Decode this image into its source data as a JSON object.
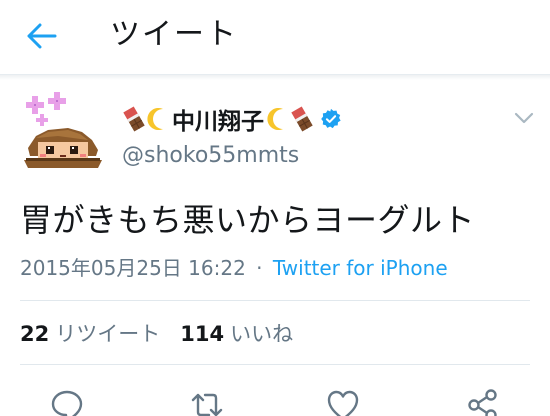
{
  "header": {
    "title": "ツイート"
  },
  "author": {
    "display_name": "中川翔子",
    "username": "@shoko55mmts",
    "verified": true
  },
  "tweet": {
    "text": "胃がきもち悪いからヨーグルト",
    "timestamp": "2015年05月25日 16:22",
    "separator": "·",
    "source": "Twitter for iPhone"
  },
  "stats": {
    "retweets_count": "22",
    "retweets_label": "リツイート",
    "likes_count": "114",
    "likes_label": "いいね"
  },
  "colors": {
    "accent": "#1da1f2",
    "text_primary": "#14171a",
    "text_secondary": "#657786",
    "divider": "#e1e8ed"
  },
  "icons": [
    "back-arrow-icon",
    "chocolate-emoji-icon",
    "crescent-moon-emoji-icon",
    "verified-badge-icon",
    "chevron-down-icon",
    "reply-icon",
    "retweet-icon",
    "like-icon",
    "share-icon"
  ]
}
